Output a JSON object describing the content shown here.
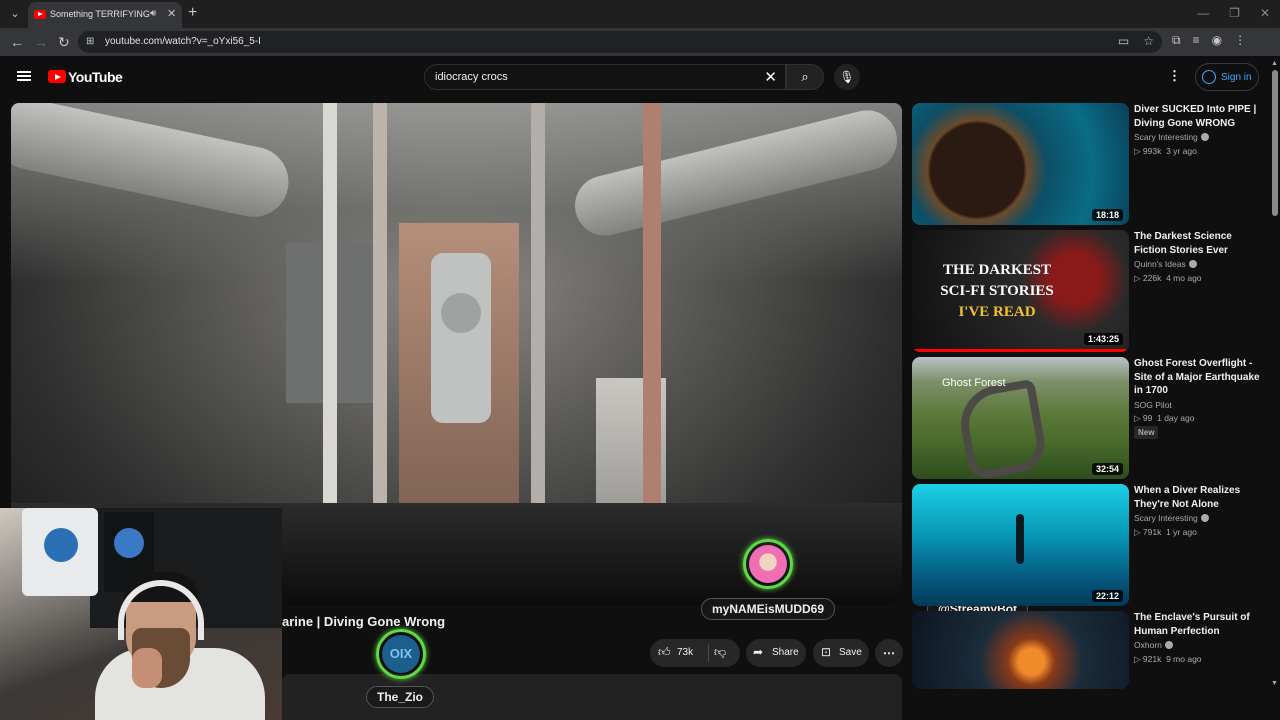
{
  "browser": {
    "tab_title": "Something TERRIFYING Dis",
    "url": "youtube.com/watch?v=_oYxi56_5-I"
  },
  "header": {
    "logo_text": "YouTube",
    "search_query": "idiocracy crocs",
    "sign_in_label": "Sign in"
  },
  "video": {
    "title_visible": "arine | Diving Gone Wrong",
    "like_count": "73k",
    "share_label": "Share",
    "save_label": "Save"
  },
  "overlay": {
    "streamers": [
      {
        "name": "The_Zio",
        "avatar_text": "OIX"
      },
      {
        "name": "myNAMEisMUDD69"
      },
      {
        "name": "@StreamyBot"
      }
    ]
  },
  "sidebar": {
    "recommendations": [
      {
        "title": "Diver SUCKED Into PIPE | Diving Gone WRONG",
        "channel": "Scary Interesting",
        "verified": true,
        "views": "993k",
        "age": "3 yr ago",
        "duration": "18:18"
      },
      {
        "title": "The Darkest Science Fiction Stories Ever",
        "channel": "Quinn's Ideas",
        "verified": true,
        "views": "226k",
        "age": "4 mo ago",
        "duration": "1:43:25",
        "thumb_text": [
          "THE DARKEST",
          "SCI-FI STORIES",
          "I'VE READ"
        ]
      },
      {
        "title": "Ghost Forest Overflight - Site of a Major Earthquake in 1700",
        "channel": "SOG Pilot",
        "verified": false,
        "views": "99",
        "age": "1 day ago",
        "badge": "New",
        "duration": "32:54",
        "thumb_text": "Ghost Forest"
      },
      {
        "title": "When a Diver Realizes They're Not Alone",
        "channel": "Scary Interesting",
        "verified": true,
        "views": "791k",
        "age": "1 yr ago",
        "duration": "22:12"
      },
      {
        "title": "The Enclave's Pursuit of Human Perfection",
        "channel": "Oxhorn",
        "verified": true,
        "views": "921k",
        "age": "9 mo ago"
      }
    ]
  },
  "colors": {
    "bg": "#0f0f0f",
    "brand_red": "#ff0000",
    "link_blue": "#3ea6ff",
    "avatar_ring": "#5fd944"
  }
}
